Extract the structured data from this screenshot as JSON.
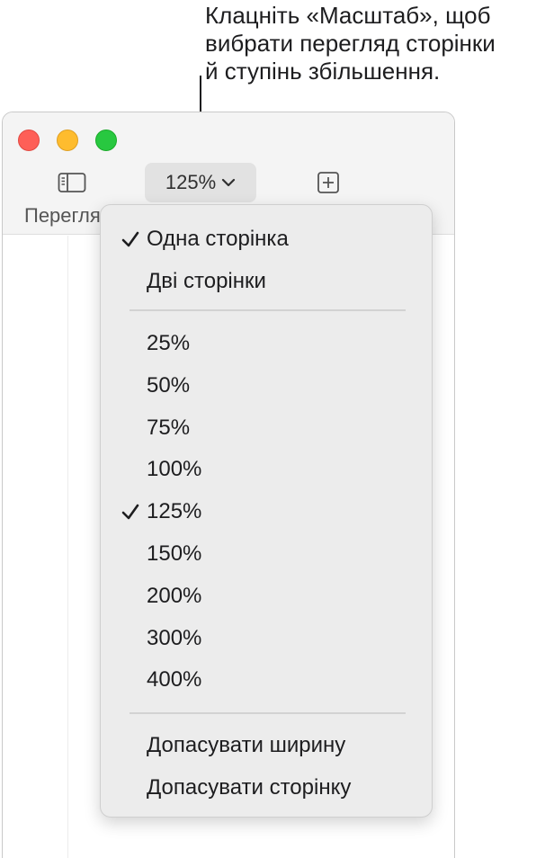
{
  "callout": {
    "lines": [
      "Клацніть «Масштаб», щоб",
      "вибрати перегляд сторінки",
      "й ступінь збільшення."
    ]
  },
  "toolbar": {
    "zoom_value": "125%",
    "view_label": "Перегляд"
  },
  "menu": {
    "page_items": [
      {
        "label": "Одна сторінка",
        "checked": true
      },
      {
        "label": "Дві сторінки",
        "checked": false
      }
    ],
    "zoom_items": [
      {
        "label": "25%",
        "checked": false
      },
      {
        "label": "50%",
        "checked": false
      },
      {
        "label": "75%",
        "checked": false
      },
      {
        "label": "100%",
        "checked": false
      },
      {
        "label": "125%",
        "checked": true
      },
      {
        "label": "150%",
        "checked": false
      },
      {
        "label": "200%",
        "checked": false
      },
      {
        "label": "300%",
        "checked": false
      },
      {
        "label": "400%",
        "checked": false
      }
    ],
    "fit_items": [
      {
        "label": "Допасувати ширину",
        "checked": false
      },
      {
        "label": "Допасувати сторінку",
        "checked": false
      }
    ]
  },
  "icons": {
    "sidebar": "sidebar-icon",
    "chevron": "chevron-down-icon",
    "add": "add-page-icon",
    "check": "checkmark-icon"
  },
  "colors": {
    "close": "#fe5f57",
    "minimize": "#febc2e",
    "zoom": "#28c840",
    "menu_bg": "#ececec",
    "zoom_button_bg": "#e2e2e2"
  }
}
